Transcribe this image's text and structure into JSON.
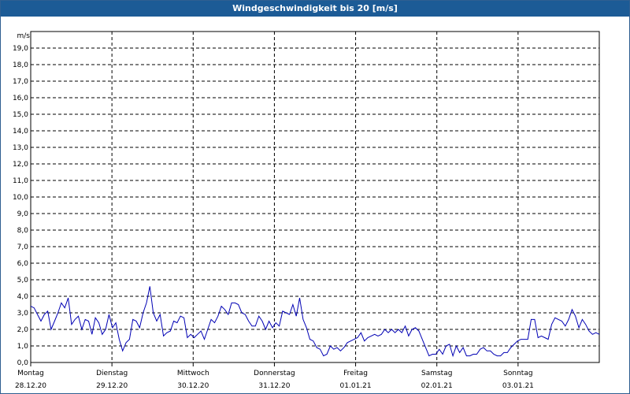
{
  "window": {
    "title": "Windgeschwindigkeit bis 20 [m/s]"
  },
  "colors": {
    "titlebar": "#1c5b96",
    "line": "#0000b4",
    "grid": "#000000"
  },
  "chart_data": {
    "type": "line",
    "title": "Windgeschwindigkeit bis 20 [m/s]",
    "ylabel": "m/s",
    "ylim": [
      0,
      20
    ],
    "yticks": [
      "0,0",
      "1,0",
      "2,0",
      "3,0",
      "4,0",
      "5,0",
      "6,0",
      "7,0",
      "8,0",
      "9,0",
      "10,0",
      "11,0",
      "12,0",
      "13,0",
      "14,0",
      "15,0",
      "16,0",
      "17,0",
      "18,0",
      "19,0"
    ],
    "grid": true,
    "x_unit": "days from Montag 28.12.20 00:00",
    "xlim": [
      0,
      7
    ],
    "days": [
      {
        "weekday": "Montag",
        "date": "28.12.20"
      },
      {
        "weekday": "Dienstag",
        "date": "29.12.20"
      },
      {
        "weekday": "Mittwoch",
        "date": "30.12.20"
      },
      {
        "weekday": "Donnerstag",
        "date": "31.12.20"
      },
      {
        "weekday": "Freitag",
        "date": "01.01.21"
      },
      {
        "weekday": "Samstag",
        "date": "02.01.21"
      },
      {
        "weekday": "Sonntag",
        "date": "03.01.21"
      }
    ],
    "series": [
      {
        "values": [
          3.4,
          3.3,
          2.9,
          2.5,
          2.9,
          3.1,
          2.0,
          2.5,
          3.0,
          3.6,
          3.3,
          3.9,
          2.3,
          2.6,
          2.8,
          2.0,
          2.6,
          2.5,
          1.7,
          2.7,
          2.4,
          1.7,
          2.0,
          2.9,
          2.1,
          2.4,
          1.4,
          0.7,
          1.2,
          1.4,
          2.6,
          2.5,
          2.1,
          3.0,
          3.6,
          4.6,
          3.0,
          2.5,
          2.9,
          1.6,
          1.8,
          1.9,
          2.5,
          2.4,
          2.8,
          2.7,
          1.5,
          1.7,
          1.5,
          1.7,
          1.9,
          1.4,
          2.0,
          2.6,
          2.4,
          2.8,
          3.4,
          3.2,
          2.9,
          3.6,
          3.6,
          3.5,
          3.0,
          2.9,
          2.5,
          2.2,
          2.2,
          2.8,
          2.5,
          2.0,
          2.5,
          2.1,
          2.4,
          2.2,
          3.1,
          3.0,
          2.9,
          3.5,
          2.8,
          3.9,
          2.6,
          2.1,
          1.4,
          1.3,
          0.9,
          0.8,
          0.4,
          0.5,
          1.0,
          0.8,
          0.9,
          0.7,
          0.9,
          1.2,
          1.3,
          1.4,
          1.5,
          1.8,
          1.3,
          1.5,
          1.6,
          1.7,
          1.6,
          1.7,
          2.0,
          1.8,
          2.0,
          1.8,
          2.0,
          1.8,
          2.2,
          1.6,
          2.0,
          2.1,
          1.9,
          1.4,
          0.9,
          0.4,
          0.5,
          0.5,
          0.8,
          0.5,
          1.0,
          1.1,
          0.4,
          1.0,
          0.6,
          0.9,
          0.4,
          0.4,
          0.5,
          0.5,
          0.8,
          0.9,
          0.7,
          0.7,
          0.5,
          0.4,
          0.4,
          0.6,
          0.6,
          0.9,
          1.1,
          1.3,
          1.4,
          1.4,
          1.4,
          2.6,
          2.6,
          1.5,
          1.6,
          1.5,
          1.4,
          2.3,
          2.7,
          2.6,
          2.5,
          2.2,
          2.6,
          3.2,
          2.8,
          2.1,
          2.6,
          2.3,
          1.9,
          1.7,
          1.8,
          1.7
        ]
      }
    ]
  }
}
